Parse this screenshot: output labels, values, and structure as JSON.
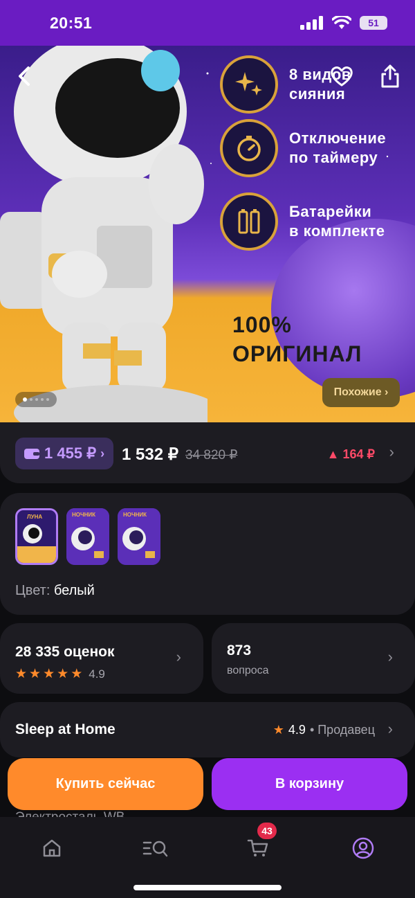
{
  "status_bar": {
    "time": "20:51",
    "battery": "51"
  },
  "hero": {
    "features": [
      {
        "text": "8 видов\nсияния",
        "icon": "sparkles-icon"
      },
      {
        "text": "Отключение\nпо таймеру",
        "icon": "timer-icon"
      },
      {
        "text": "Батарейки\nв комплекте",
        "icon": "battery-icon"
      }
    ],
    "original_text": "100%\nОРИГИНАЛ",
    "similar_label": "Похожие ›",
    "dots_total": 5,
    "dots_active": 1
  },
  "price": {
    "wallet_price": "1 455 ₽",
    "price": "1 532 ₽",
    "old_price": "34 820 ₽",
    "delta": "164 ₽"
  },
  "variants": {
    "thumbs": [
      "ЛУНА",
      "НОЧНИК",
      "НОЧНИК"
    ],
    "color_label": "Цвет:",
    "color_value": "белый"
  },
  "reviews": {
    "count": "28 335 оценок",
    "rating": "4.9",
    "stars": 5
  },
  "questions": {
    "count": "873",
    "label": "вопроса"
  },
  "seller": {
    "name": "Sleep at Home",
    "rating": "4.9",
    "label": "• Продавец"
  },
  "actions": {
    "buy_now": "Купить сейчас",
    "add_to_cart": "В корзину"
  },
  "peek_text": "Электросталь WB",
  "tabbar": {
    "cart_count": "43"
  },
  "colors": {
    "accent": "#9b2ff2",
    "orange": "#ff8a2b",
    "status_bg": "#6a1cc2"
  }
}
